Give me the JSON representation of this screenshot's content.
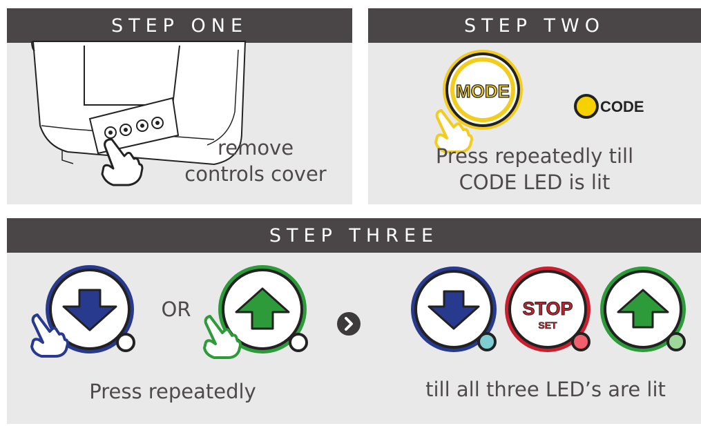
{
  "step_one": {
    "title": "STEP ONE",
    "caption_line1": "remove",
    "caption_line2": "controls cover",
    "icons": [
      "opener-unit-illustration",
      "hand-pointer-icon"
    ]
  },
  "step_two": {
    "title": "STEP TWO",
    "mode_button_label": "MODE",
    "led_label": "CODE",
    "caption_line1": "Press repeatedly till",
    "caption_line2": "CODE LED is lit"
  },
  "step_three": {
    "title": "STEP THREE",
    "or_label": "OR",
    "caption_left": "Press repeatedly",
    "caption_right": "till all three LED’s are lit",
    "stop_label": "STOP",
    "set_label": "SET"
  },
  "colors": {
    "header_bg": "#4a4546",
    "panel_bg": "#e9e9e9",
    "down_blue": "#283a8e",
    "up_green": "#2d9b39",
    "stop_red": "#c8202e",
    "mode_yellow": "#f2cc1f",
    "led_yellow": "#f6d100",
    "led_cyan": "#7fcdd1",
    "led_pink": "#f0616d",
    "led_green": "#9fd69a"
  }
}
